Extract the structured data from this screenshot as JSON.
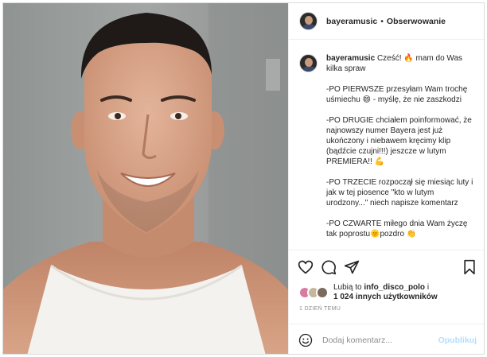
{
  "post": {
    "username": "bayeramusic",
    "separator": "•",
    "follow_label": "Obserwowanie"
  },
  "caption": {
    "username": "bayeramusic",
    "paragraphs": [
      "Cześć! 🔥 mam do Was kilka spraw",
      "-PO PIERWSZE przesyłam Wam trochę uśmiechu 😄 - myślę, że nie zaszkodzi",
      "-PO DRUGIE chciałem poinformować, że najnowszy numer Bayera jest już ukończony i niebawem kręcimy klip (bądźcie czujni!!!) jeszcze w lutym PREMIERA!! 💪",
      "-PO TRZECIE rozpoczął się miesiąc luty i jak w tej piosence \"kto w lutym urodzony...\" niech napisze komentarz",
      "-PO CZWARTE miłego dnia Wam życzę tak poprostu🌞pozdro 👏"
    ]
  },
  "icons": {
    "like": "heart-icon",
    "comment": "comment-icon",
    "share": "paper-plane-icon",
    "save": "bookmark-icon",
    "emoji": "smiley-icon"
  },
  "likes": {
    "prefix": "Lubią to",
    "first_user": "info_disco_polo",
    "connector": "i",
    "others": "1 024 innych użytkowników"
  },
  "timestamp": "1 DZIEŃ TEMU",
  "comment_box": {
    "placeholder": "Dodaj komentarz...",
    "publish_label": "Opublikuj"
  },
  "colors": {
    "publish_disabled": "#b2dffc",
    "muted_text": "#8e8e8e",
    "border": "#efefef"
  }
}
